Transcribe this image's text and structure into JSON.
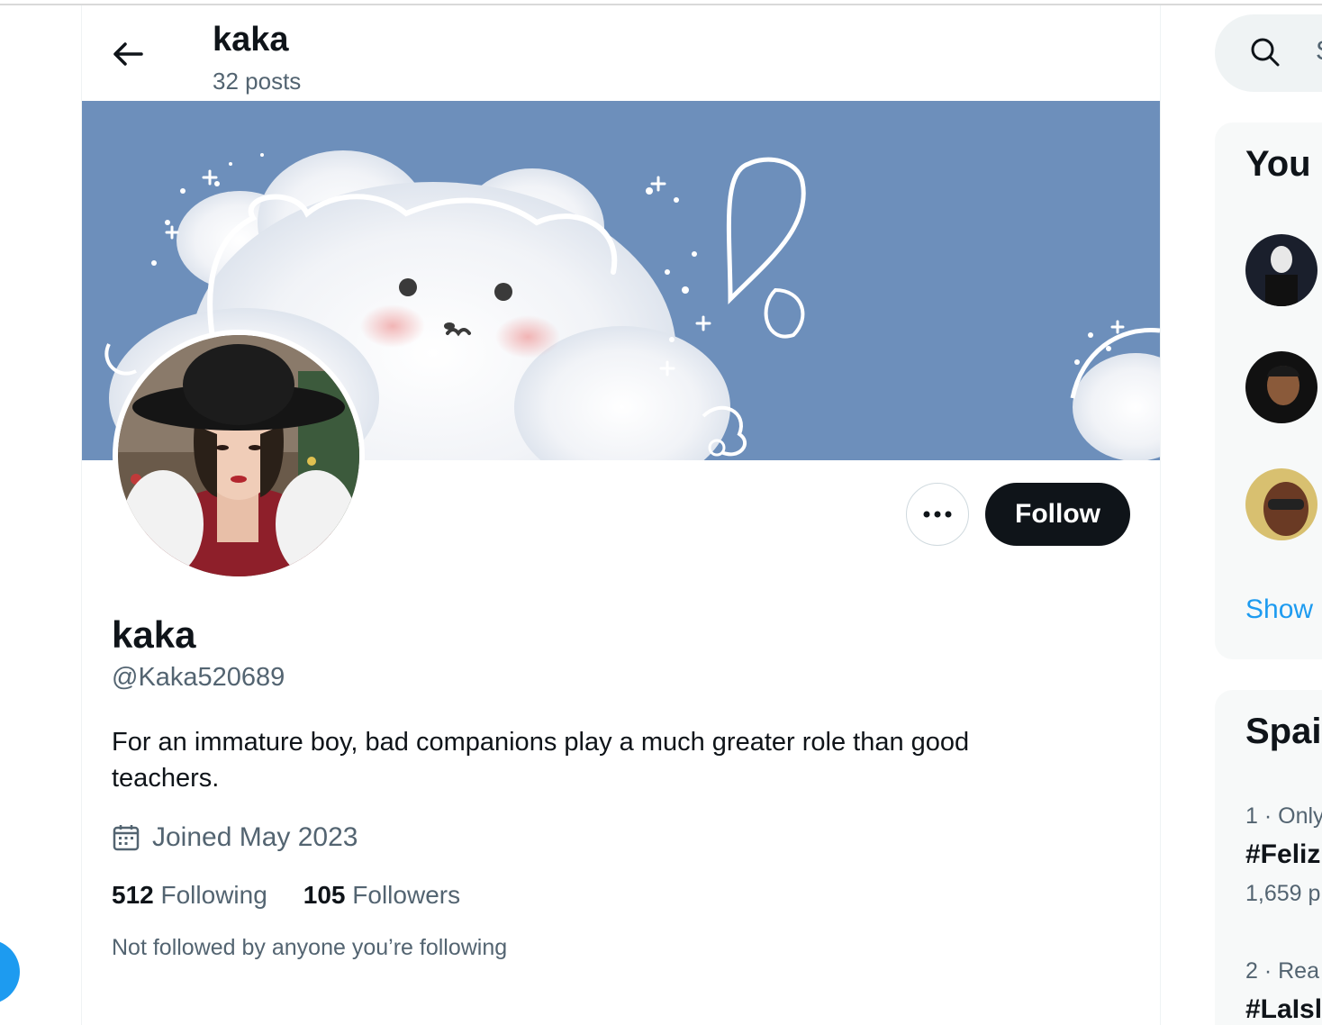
{
  "header": {
    "title": "kaka",
    "post_count": "32 posts"
  },
  "profile": {
    "display_name": "kaka",
    "handle": "@Kaka520689",
    "bio": "For an immature boy, bad companions play a much greater role than good teachers.",
    "joined": "Joined May 2023",
    "following_count": "512",
    "following_label": "Following",
    "followers_count": "105",
    "followers_label": "Followers",
    "not_followed_text": "Not followed by anyone you’re following"
  },
  "actions": {
    "follow_label": "Follow",
    "more_icon": "ellipsis-icon"
  },
  "sidebar": {
    "search_placeholder": "S",
    "who_to_follow_title": "You",
    "show_more": "Show",
    "trends_title": "Spai",
    "trends": [
      {
        "meta": "1 · Only",
        "name": "#Feliz",
        "posts": "1,659 p"
      },
      {
        "meta": "2 · Rea",
        "name": "#LaIsl",
        "posts": ""
      }
    ]
  },
  "colors": {
    "banner_blue": "#6d8fbb",
    "follow_button": "#0f1419",
    "link_blue": "#1d9bf0",
    "secondary_text": "#536471"
  }
}
